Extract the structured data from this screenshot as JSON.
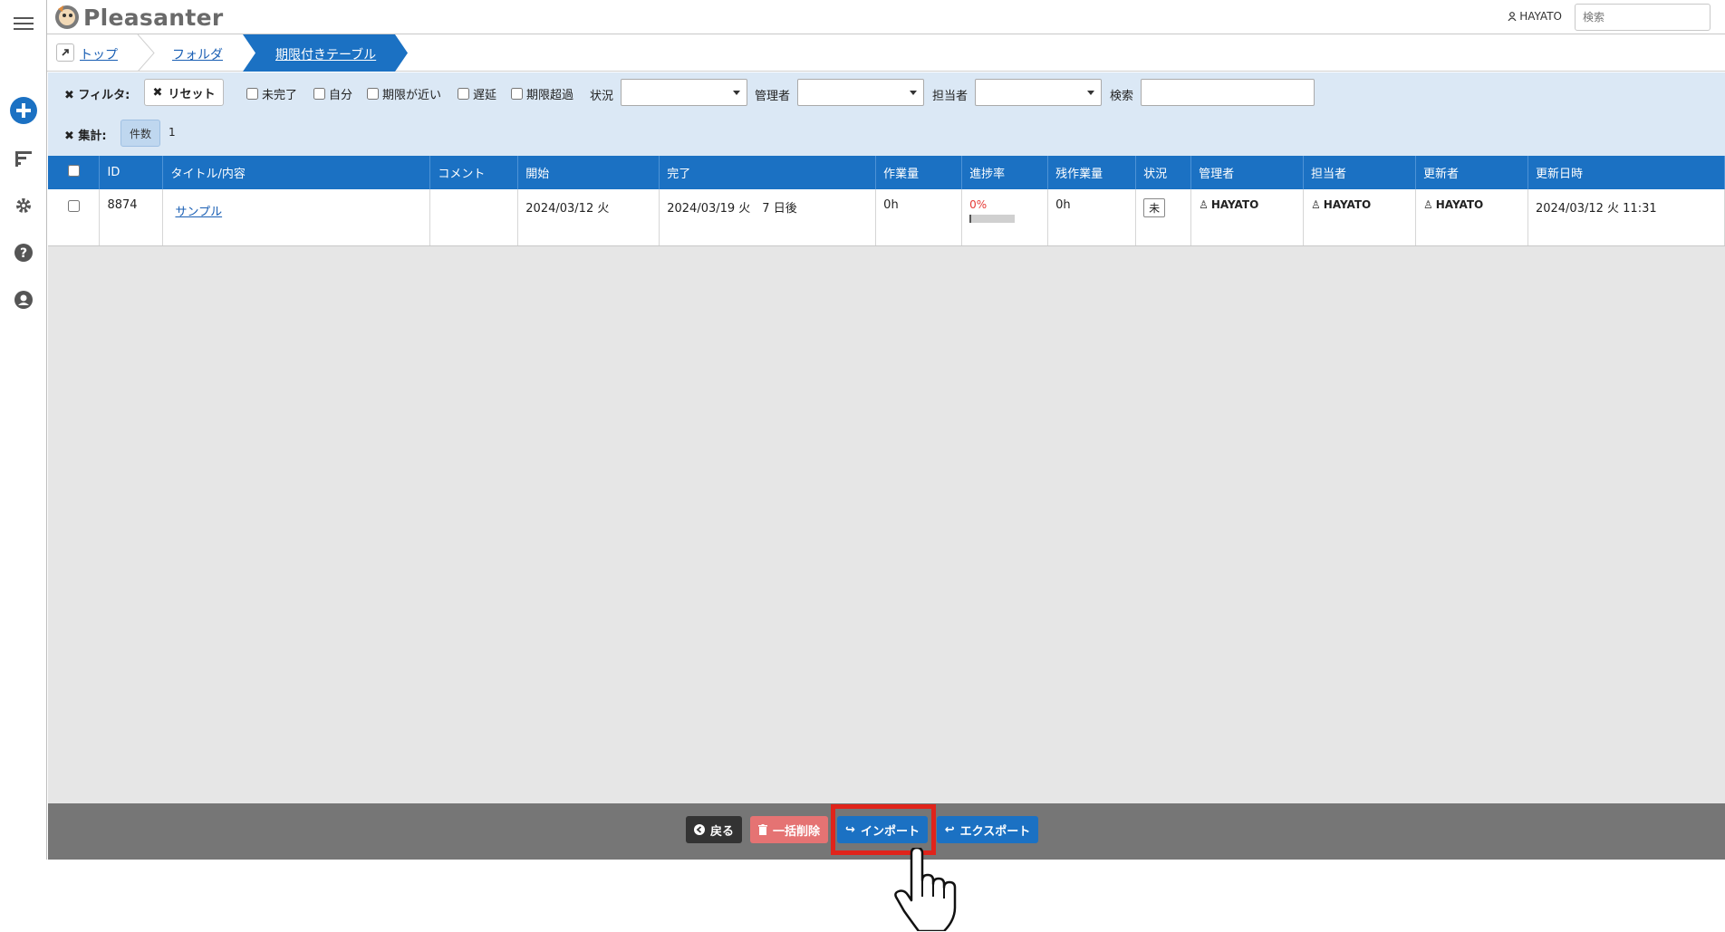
{
  "app": {
    "logo_text": "Pleasanter"
  },
  "header": {
    "user_name": "HAYATO",
    "search_placeholder": "検索"
  },
  "breadcrumb": {
    "items": [
      "トップ",
      "フォルダ",
      "期限付きテーブル"
    ]
  },
  "filters": {
    "filter_label": "フィルタ:",
    "reset_label": "リセット",
    "checkboxes": [
      "未完了",
      "自分",
      "期限が近い",
      "遅延",
      "期限超過"
    ],
    "selects": [
      {
        "label": "状況",
        "value": ""
      },
      {
        "label": "管理者",
        "value": ""
      },
      {
        "label": "担当者",
        "value": ""
      }
    ],
    "search_label": "検索",
    "search_value": "",
    "aggregation_label": "集計:",
    "aggregation_button": "件数",
    "aggregation_value": "1"
  },
  "grid": {
    "columns": [
      "ID",
      "タイトル/内容",
      "コメント",
      "開始",
      "完了",
      "作業量",
      "進捗率",
      "残作業量",
      "状況",
      "管理者",
      "担当者",
      "更新者",
      "更新日時"
    ],
    "rows": [
      {
        "id": "8874",
        "title": "サンプル",
        "comment": "",
        "start": "2024/03/12 火",
        "end": "2024/03/19 火　7 日後",
        "work_value": "0h",
        "progress": "0%",
        "progress_fraction": 0.04,
        "remaining": "0h",
        "status": "未",
        "manager": "HAYATO",
        "owner": "HAYATO",
        "updator": "HAYATO",
        "updated_time": "2024/03/12 火 11:31"
      }
    ]
  },
  "footer": {
    "back_label": "戻る",
    "bulk_delete_label": "一括削除",
    "import_label": "インポート",
    "export_label": "エクスポート"
  },
  "colors": {
    "accent": "#1b71c3",
    "filter_bg": "#dbe8f5",
    "footer_bg": "#767676",
    "delete_btn": "#e57373",
    "highlight": "#e0241b"
  }
}
